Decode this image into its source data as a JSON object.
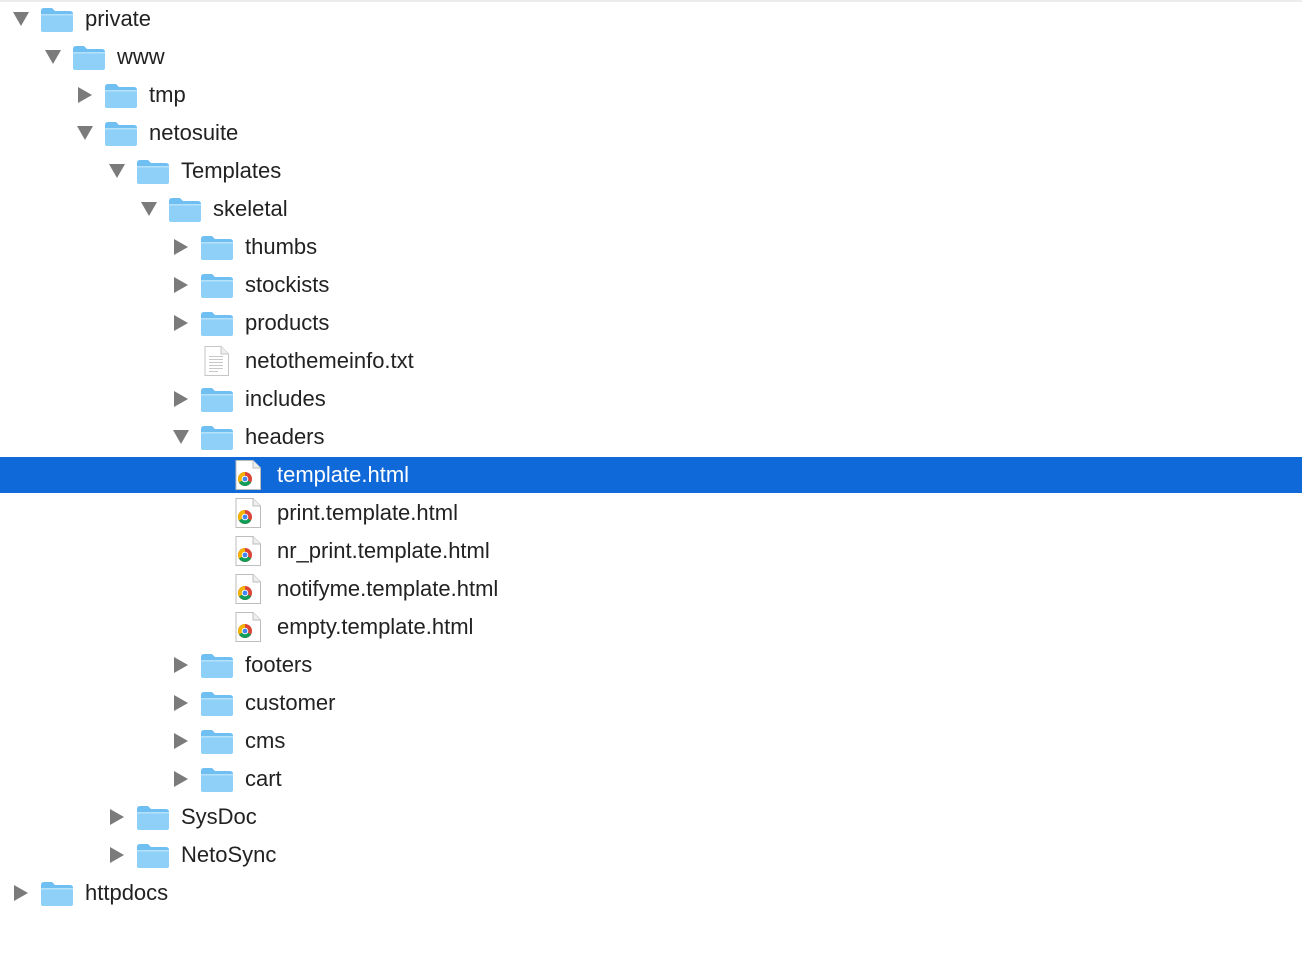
{
  "colors": {
    "selection": "#1069d8",
    "folder_body": "#8fd0f9",
    "folder_tab": "#6fbff3",
    "disclosure": "#7b7b7b"
  },
  "tree": [
    {
      "label": "private",
      "kind": "folder",
      "depth": 0,
      "expanded": true,
      "icon": "folder-icon"
    },
    {
      "label": "www",
      "kind": "folder",
      "depth": 1,
      "expanded": true,
      "icon": "folder-icon"
    },
    {
      "label": "tmp",
      "kind": "folder",
      "depth": 2,
      "expanded": false,
      "icon": "folder-icon"
    },
    {
      "label": "netosuite",
      "kind": "folder",
      "depth": 2,
      "expanded": true,
      "icon": "folder-icon"
    },
    {
      "label": "Templates",
      "kind": "folder",
      "depth": 3,
      "expanded": true,
      "icon": "folder-icon"
    },
    {
      "label": "skeletal",
      "kind": "folder",
      "depth": 4,
      "expanded": true,
      "icon": "folder-icon"
    },
    {
      "label": "thumbs",
      "kind": "folder",
      "depth": 5,
      "expanded": false,
      "icon": "folder-icon"
    },
    {
      "label": "stockists",
      "kind": "folder",
      "depth": 5,
      "expanded": false,
      "icon": "folder-icon"
    },
    {
      "label": "products",
      "kind": "folder",
      "depth": 5,
      "expanded": false,
      "icon": "folder-icon"
    },
    {
      "label": "netothemeinfo.txt",
      "kind": "text",
      "depth": 5,
      "icon": "text-file-icon"
    },
    {
      "label": "includes",
      "kind": "folder",
      "depth": 5,
      "expanded": false,
      "icon": "folder-icon"
    },
    {
      "label": "headers",
      "kind": "folder",
      "depth": 5,
      "expanded": true,
      "icon": "folder-icon"
    },
    {
      "label": "template.html",
      "kind": "html",
      "depth": 6,
      "selected": true,
      "icon": "chrome-html-file-icon"
    },
    {
      "label": "print.template.html",
      "kind": "html",
      "depth": 6,
      "icon": "chrome-html-file-icon"
    },
    {
      "label": "nr_print.template.html",
      "kind": "html",
      "depth": 6,
      "icon": "chrome-html-file-icon"
    },
    {
      "label": "notifyme.template.html",
      "kind": "html",
      "depth": 6,
      "icon": "chrome-html-file-icon"
    },
    {
      "label": "empty.template.html",
      "kind": "html",
      "depth": 6,
      "icon": "chrome-html-file-icon"
    },
    {
      "label": "footers",
      "kind": "folder",
      "depth": 5,
      "expanded": false,
      "icon": "folder-icon"
    },
    {
      "label": "customer",
      "kind": "folder",
      "depth": 5,
      "expanded": false,
      "icon": "folder-icon"
    },
    {
      "label": "cms",
      "kind": "folder",
      "depth": 5,
      "expanded": false,
      "icon": "folder-icon"
    },
    {
      "label": "cart",
      "kind": "folder",
      "depth": 5,
      "expanded": false,
      "icon": "folder-icon"
    },
    {
      "label": "SysDoc",
      "kind": "folder",
      "depth": 3,
      "expanded": false,
      "icon": "folder-icon"
    },
    {
      "label": "NetoSync",
      "kind": "folder",
      "depth": 3,
      "expanded": false,
      "icon": "folder-icon"
    },
    {
      "label": "httpdocs",
      "kind": "folder",
      "depth": 0,
      "expanded": false,
      "icon": "folder-icon"
    }
  ]
}
